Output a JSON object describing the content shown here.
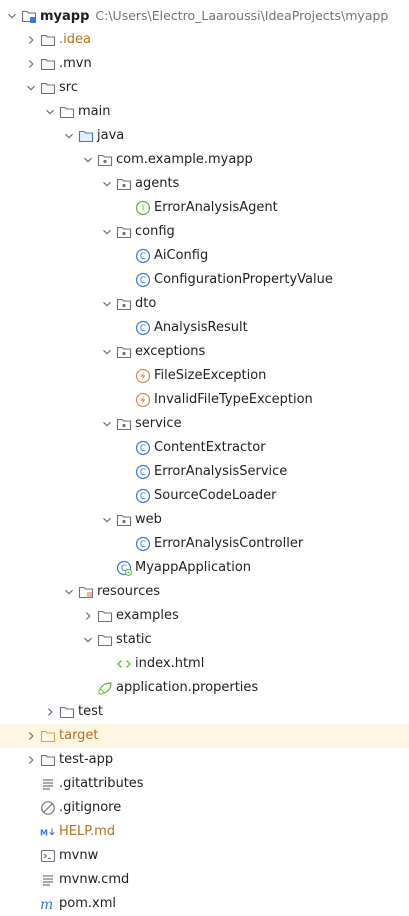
{
  "tree": [
    {
      "depth": 0,
      "state": "open",
      "icon": "module-folder",
      "label": "myapp",
      "bold": true,
      "path": "C:\\Users\\Electro_Laaroussi\\IdeaProjects\\myapp"
    },
    {
      "depth": 1,
      "state": "closed",
      "icon": "folder",
      "label": ".idea",
      "color": "orange"
    },
    {
      "depth": 1,
      "state": "closed",
      "icon": "folder",
      "label": ".mvn"
    },
    {
      "depth": 1,
      "state": "open",
      "icon": "folder",
      "label": "src"
    },
    {
      "depth": 2,
      "state": "open",
      "icon": "folder",
      "label": "main"
    },
    {
      "depth": 3,
      "state": "open",
      "icon": "source-folder",
      "label": "java"
    },
    {
      "depth": 4,
      "state": "open",
      "icon": "package",
      "label": "com.example.myapp"
    },
    {
      "depth": 5,
      "state": "open",
      "icon": "package",
      "label": "agents"
    },
    {
      "depth": 6,
      "state": "none",
      "icon": "interface",
      "label": "ErrorAnalysisAgent"
    },
    {
      "depth": 5,
      "state": "open",
      "icon": "package",
      "label": "config"
    },
    {
      "depth": 6,
      "state": "none",
      "icon": "class",
      "label": "AiConfig"
    },
    {
      "depth": 6,
      "state": "none",
      "icon": "class",
      "label": "ConfigurationPropertyValue"
    },
    {
      "depth": 5,
      "state": "open",
      "icon": "package",
      "label": "dto"
    },
    {
      "depth": 6,
      "state": "none",
      "icon": "class",
      "label": "AnalysisResult"
    },
    {
      "depth": 5,
      "state": "open",
      "icon": "package",
      "label": "exceptions"
    },
    {
      "depth": 6,
      "state": "none",
      "icon": "exception",
      "label": "FileSizeException"
    },
    {
      "depth": 6,
      "state": "none",
      "icon": "exception",
      "label": "InvalidFileTypeException"
    },
    {
      "depth": 5,
      "state": "open",
      "icon": "package",
      "label": "service"
    },
    {
      "depth": 6,
      "state": "none",
      "icon": "class",
      "label": "ContentExtractor"
    },
    {
      "depth": 6,
      "state": "none",
      "icon": "class",
      "label": "ErrorAnalysisService"
    },
    {
      "depth": 6,
      "state": "none",
      "icon": "class",
      "label": "SourceCodeLoader"
    },
    {
      "depth": 5,
      "state": "open",
      "icon": "package",
      "label": "web"
    },
    {
      "depth": 6,
      "state": "none",
      "icon": "class",
      "label": "ErrorAnalysisController"
    },
    {
      "depth": 5,
      "state": "none",
      "icon": "spring-class",
      "label": "MyappApplication"
    },
    {
      "depth": 3,
      "state": "open",
      "icon": "resources-folder",
      "label": "resources"
    },
    {
      "depth": 4,
      "state": "closed",
      "icon": "folder",
      "label": "examples"
    },
    {
      "depth": 4,
      "state": "open",
      "icon": "folder",
      "label": "static"
    },
    {
      "depth": 5,
      "state": "none",
      "icon": "html",
      "label": "index.html"
    },
    {
      "depth": 4,
      "state": "none",
      "icon": "properties",
      "label": "application.properties"
    },
    {
      "depth": 2,
      "state": "closed",
      "icon": "folder",
      "label": "test"
    },
    {
      "depth": 1,
      "state": "closed",
      "icon": "excluded-folder",
      "label": "target",
      "color": "orange",
      "highlight": true
    },
    {
      "depth": 1,
      "state": "closed",
      "icon": "folder",
      "label": "test-app"
    },
    {
      "depth": 1,
      "state": "none",
      "icon": "text-file",
      "label": ".gitattributes"
    },
    {
      "depth": 1,
      "state": "none",
      "icon": "ignore-file",
      "label": ".gitignore"
    },
    {
      "depth": 1,
      "state": "none",
      "icon": "markdown",
      "label": "HELP.md",
      "color": "orange"
    },
    {
      "depth": 1,
      "state": "none",
      "icon": "shell",
      "label": "mvnw"
    },
    {
      "depth": 1,
      "state": "none",
      "icon": "text-file",
      "label": "mvnw.cmd"
    },
    {
      "depth": 1,
      "state": "none",
      "icon": "maven",
      "label": "pom.xml"
    }
  ],
  "colors": {
    "class_blue": "#3574f0",
    "exception_orange": "#e08855",
    "spring_green": "#5fb832",
    "folder_grey": "#6c707e",
    "excluded_orange": "#e5a050",
    "orange_text": "#b86f1e",
    "highlight_bg": "#fdf6e3"
  }
}
